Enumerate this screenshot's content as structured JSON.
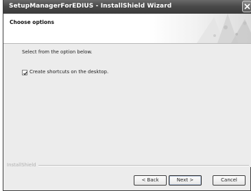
{
  "window": {
    "title": "SetupManagerForEDIUS - InstallShield Wizard",
    "close_icon": "close-icon"
  },
  "header": {
    "title": "Choose options"
  },
  "content": {
    "instruction": "Select from the option below.",
    "option": {
      "label": "Create shortcuts on the desktop.",
      "checked": true
    }
  },
  "footer": {
    "brand": "InstallShield",
    "buttons": {
      "back": "< Back",
      "next": "Next >",
      "cancel": "Cancel"
    }
  }
}
